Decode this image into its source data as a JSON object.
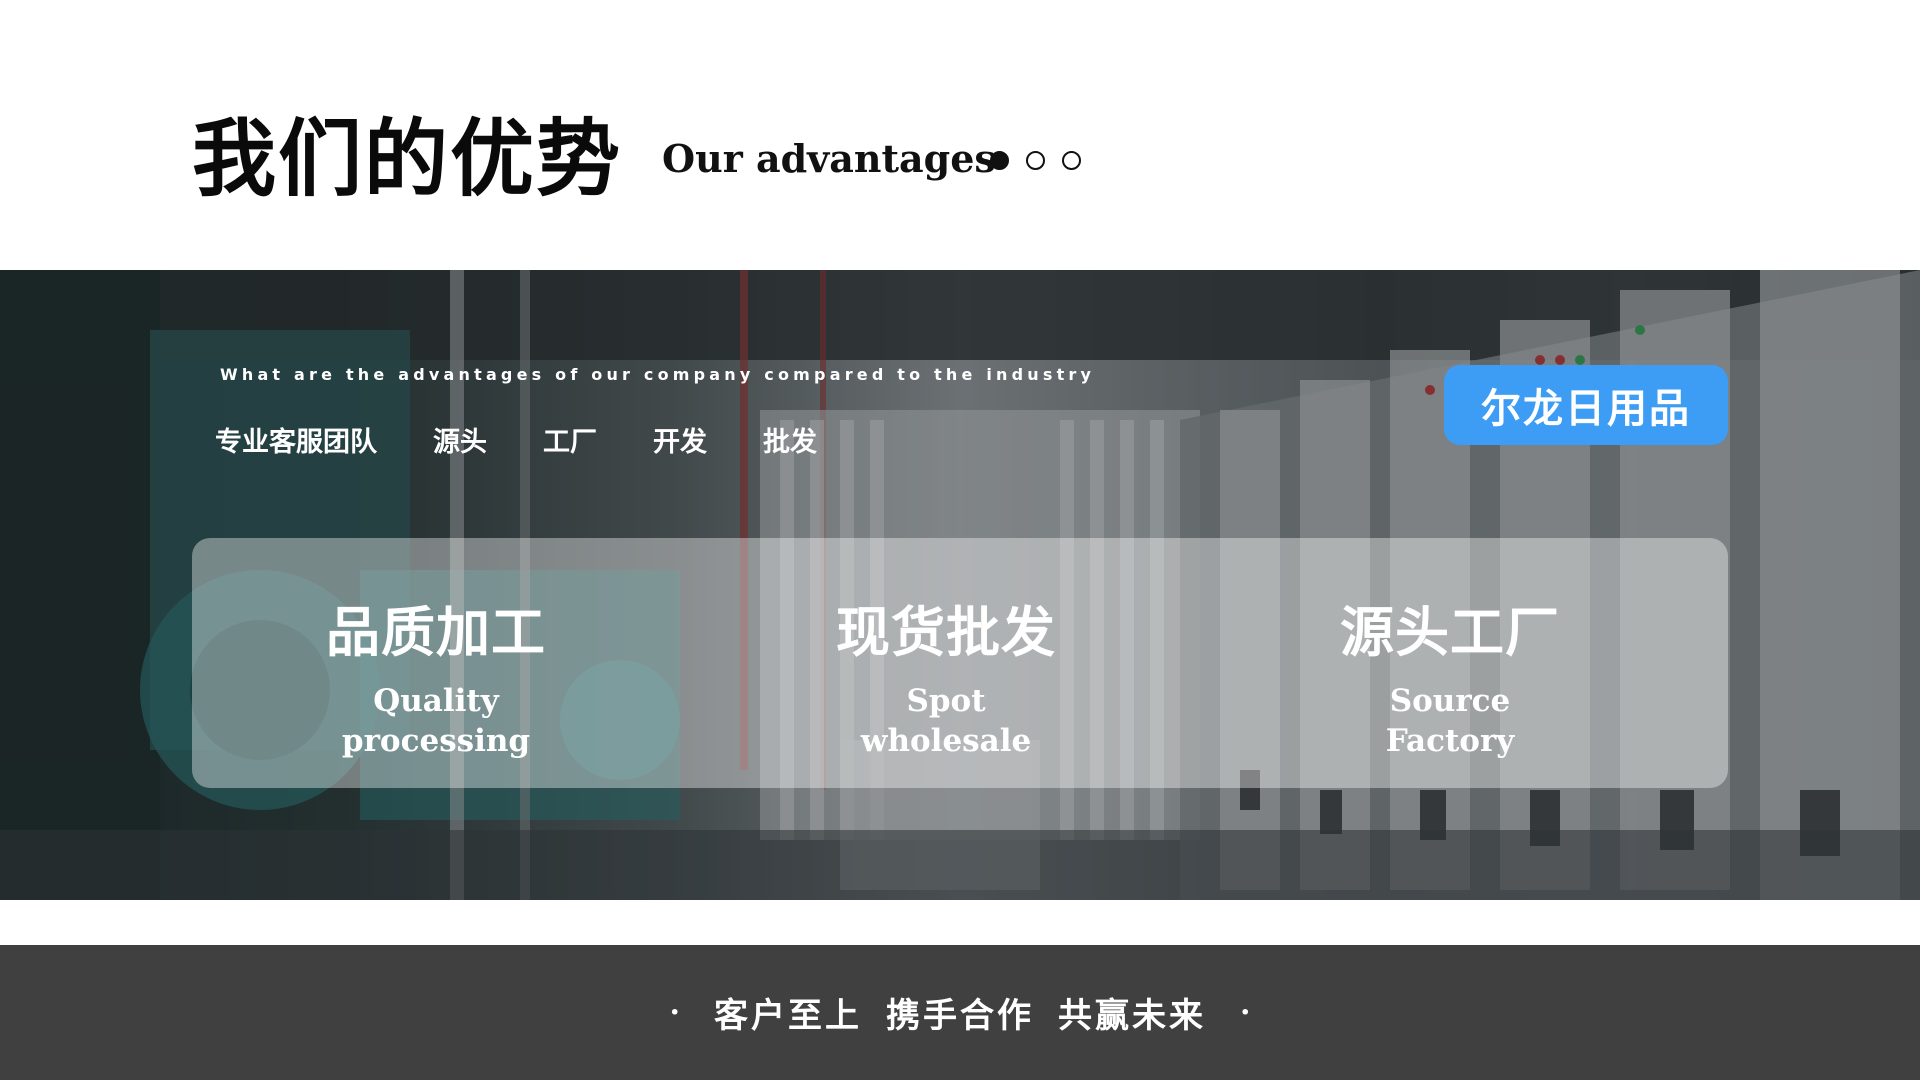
{
  "header": {
    "title_cn": "我们的优势",
    "title_en": "Our advantages",
    "pagination": {
      "total": 3,
      "active": 1
    }
  },
  "hero": {
    "subtitle": "What are the advantages of our company compared to the industry",
    "tabs": [
      "专业客服团队",
      "源头",
      "工厂",
      "开发",
      "批发"
    ],
    "brand_badge": "尔龙日用品",
    "brand_color": "#3d9cf3"
  },
  "features": [
    {
      "cn": "品质加工",
      "en_line1": "Quality",
      "en_line2": "processing"
    },
    {
      "cn": "现货批发",
      "en_line1": "Spot",
      "en_line2": "wholesale"
    },
    {
      "cn": "源头工厂",
      "en_line1": "Source",
      "en_line2": "Factory"
    }
  ],
  "footer": {
    "slogans": [
      "客户至上",
      "携手合作",
      "共赢未来"
    ],
    "separator": "·"
  }
}
